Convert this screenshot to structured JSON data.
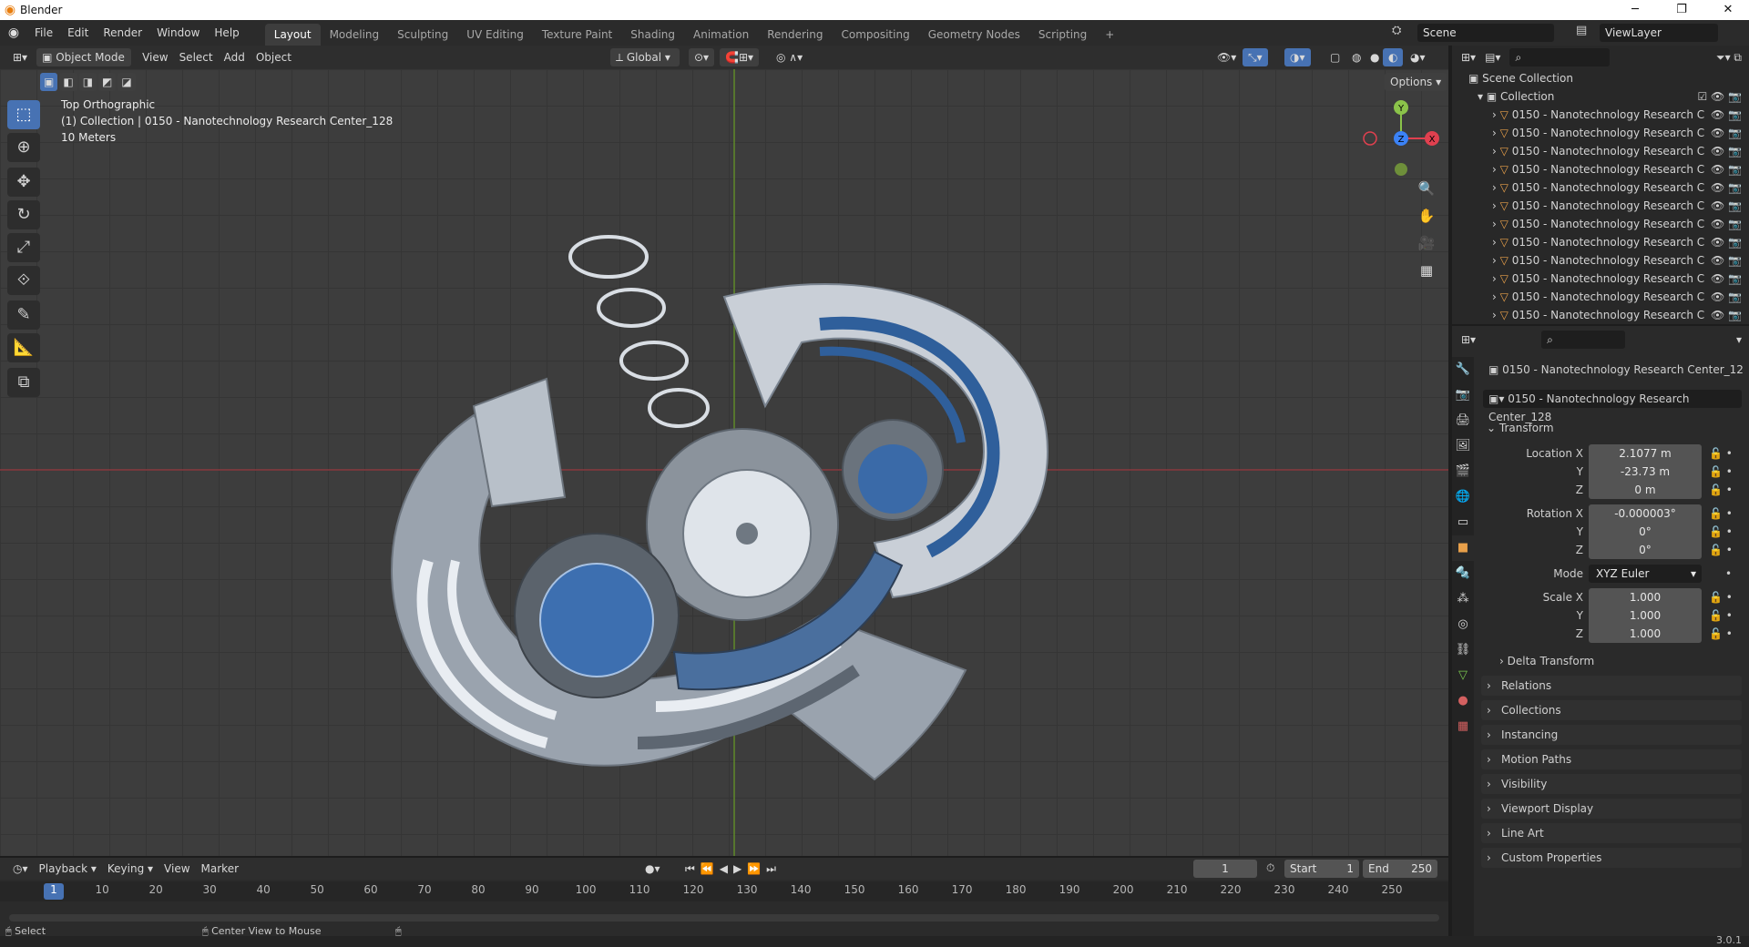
{
  "window": {
    "title": "Blender",
    "minimize": "─",
    "maximize": "❐",
    "close": "✕"
  },
  "menu": [
    "File",
    "Edit",
    "Render",
    "Window",
    "Help"
  ],
  "workspaces": [
    "Layout",
    "Modeling",
    "Sculpting",
    "UV Editing",
    "Texture Paint",
    "Shading",
    "Animation",
    "Rendering",
    "Compositing",
    "Geometry Nodes",
    "Scripting",
    "+"
  ],
  "scene": {
    "name": "Scene",
    "view_layer": "ViewLayer"
  },
  "viewport_header": {
    "mode": "Object Mode",
    "menus": [
      "View",
      "Select",
      "Add",
      "Object"
    ],
    "orientation": "Global",
    "options": "Options"
  },
  "viewport_info": {
    "view": "Top Orthographic",
    "collection": "(1) Collection | 0150 - Nanotechnology Research Center_128",
    "scale": "10 Meters"
  },
  "gizmo": {
    "x": "X",
    "y": "Y",
    "z": "Z"
  },
  "outliner": {
    "root": "Scene Collection",
    "collection": "Collection",
    "items": [
      "0150 - Nanotechnology Research C",
      "0150 - Nanotechnology Research C",
      "0150 - Nanotechnology Research C",
      "0150 - Nanotechnology Research C",
      "0150 - Nanotechnology Research C",
      "0150 - Nanotechnology Research C",
      "0150 - Nanotechnology Research C",
      "0150 - Nanotechnology Research C",
      "0150 - Nanotechnology Research C",
      "0150 - Nanotechnology Research C",
      "0150 - Nanotechnology Research C",
      "0150 - Nanotechnology Research C"
    ]
  },
  "properties": {
    "object_name": "0150 - Nanotechnology Research Center_12",
    "data_name": "0150 - Nanotechnology Research Center_128",
    "transform_title": "Transform",
    "location_label": "Location X",
    "loc_x": "2.1077 m",
    "loc_y": "-23.73 m",
    "loc_z": "0 m",
    "rotation_label": "Rotation X",
    "rot_x": "-0.000003°",
    "rot_y": "0°",
    "rot_z": "0°",
    "mode_label": "Mode",
    "mode": "XYZ Euler",
    "scale_label": "Scale X",
    "scale_x": "1.000",
    "scale_y": "1.000",
    "scale_z": "1.000",
    "y": "Y",
    "z": "Z",
    "delta": "Delta Transform",
    "sections": [
      "Relations",
      "Collections",
      "Instancing",
      "Motion Paths",
      "Visibility",
      "Viewport Display",
      "Line Art",
      "Custom Properties"
    ]
  },
  "timeline": {
    "menus": [
      "Playback",
      "Keying",
      "View",
      "Marker"
    ],
    "current": "1",
    "start_label": "Start",
    "start": "1",
    "end_label": "End",
    "end": "250",
    "ticks": [
      "1",
      "10",
      "20",
      "30",
      "40",
      "50",
      "60",
      "70",
      "80",
      "90",
      "100",
      "110",
      "120",
      "130",
      "140",
      "150",
      "160",
      "170",
      "180",
      "190",
      "200",
      "210",
      "220",
      "230",
      "240",
      "250"
    ]
  },
  "status": {
    "select": "Select",
    "center": "Center View to Mouse",
    "version": "3.0.1"
  },
  "colors": {
    "accent": "#4772b3",
    "x_axis": "#e0404f",
    "y_axis": "#8bc34a",
    "z_axis": "#3b82f6"
  }
}
